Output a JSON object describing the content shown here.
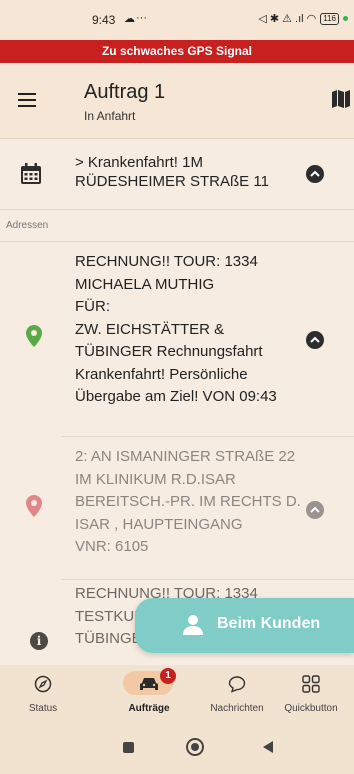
{
  "status_bar": {
    "time": "9:43",
    "cloud": "☁",
    "dots": "···",
    "right_icons": "◁ ✱ ⚠ .ıl ◠",
    "battery": "116"
  },
  "gps_banner": "Zu schwaches GPS Signal",
  "header": {
    "title": "Auftrag 1",
    "subtitle": "In Anfahrt"
  },
  "appointment": {
    "line1": "> Krankenfahrt! 1M",
    "line2": "RÜDESHEIMER STRAßE 11"
  },
  "section_label": "Adressen",
  "addresses": [
    {
      "lines": [
        "RECHNUNG!! TOUR: 1334",
        "MICHAELA MUTHIG",
        "FÜR:",
        "ZW. EICHSTÄTTER &",
        "TÜBINGER Rechnungsfahrt",
        "Krankenfahrt! Persönliche",
        "Übergabe am Ziel! VON 09:43"
      ]
    },
    {
      "lines": [
        "2: AN ISMANINGER STRAßE 22",
        "IM KLINIKUM R.D.ISAR",
        "BEREITSCH.-PR. IM RECHTS D.",
        "ISAR , HAUPTEINGANG",
        "VNR: 6105"
      ]
    },
    {
      "lines": [
        "RECHNUNG!! TOUR: 1334",
        "TESTKUNDE",
        "TÜBINGER"
      ]
    }
  ],
  "fab_label": "Beim Kunden",
  "bottom_nav": {
    "status": "Status",
    "orders": "Aufträge",
    "orders_badge": "1",
    "messages": "Nachrichten",
    "quickbuttons": "Quickbutton"
  },
  "colors": {
    "banner": "#c81f1f",
    "background": "#f6ece1",
    "fab": "#7fcdc6",
    "pin_start": "#5aa848",
    "pin_dest": "#e1868a"
  }
}
